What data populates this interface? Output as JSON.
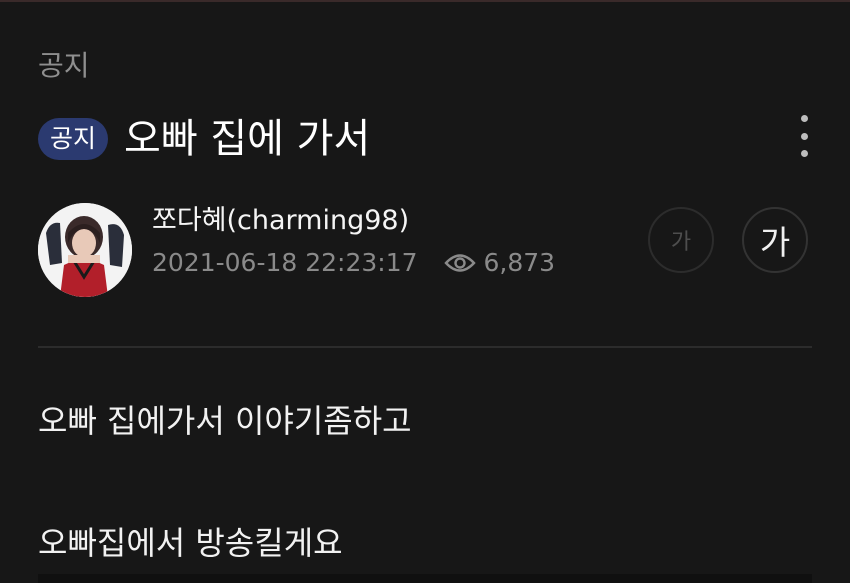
{
  "board": {
    "category": "공지"
  },
  "post": {
    "badge": "공지",
    "title": "오빠 집에 가서",
    "author": "쪼다혜(charming98)",
    "datetime": "2021-06-18 22:23:17",
    "views": "6,873",
    "icons": {
      "views": "eye-icon",
      "more": "more-vertical-icon"
    }
  },
  "font_size_buttons": {
    "smaller": "가",
    "larger": "가"
  },
  "content": {
    "lines": [
      "오빠 집에가서 이야기좀하고",
      "오빠집에서 방송킬게요"
    ]
  },
  "colors": {
    "background": "#171717",
    "badge": "#2b3a70",
    "muted_text": "#8a8a8a"
  }
}
